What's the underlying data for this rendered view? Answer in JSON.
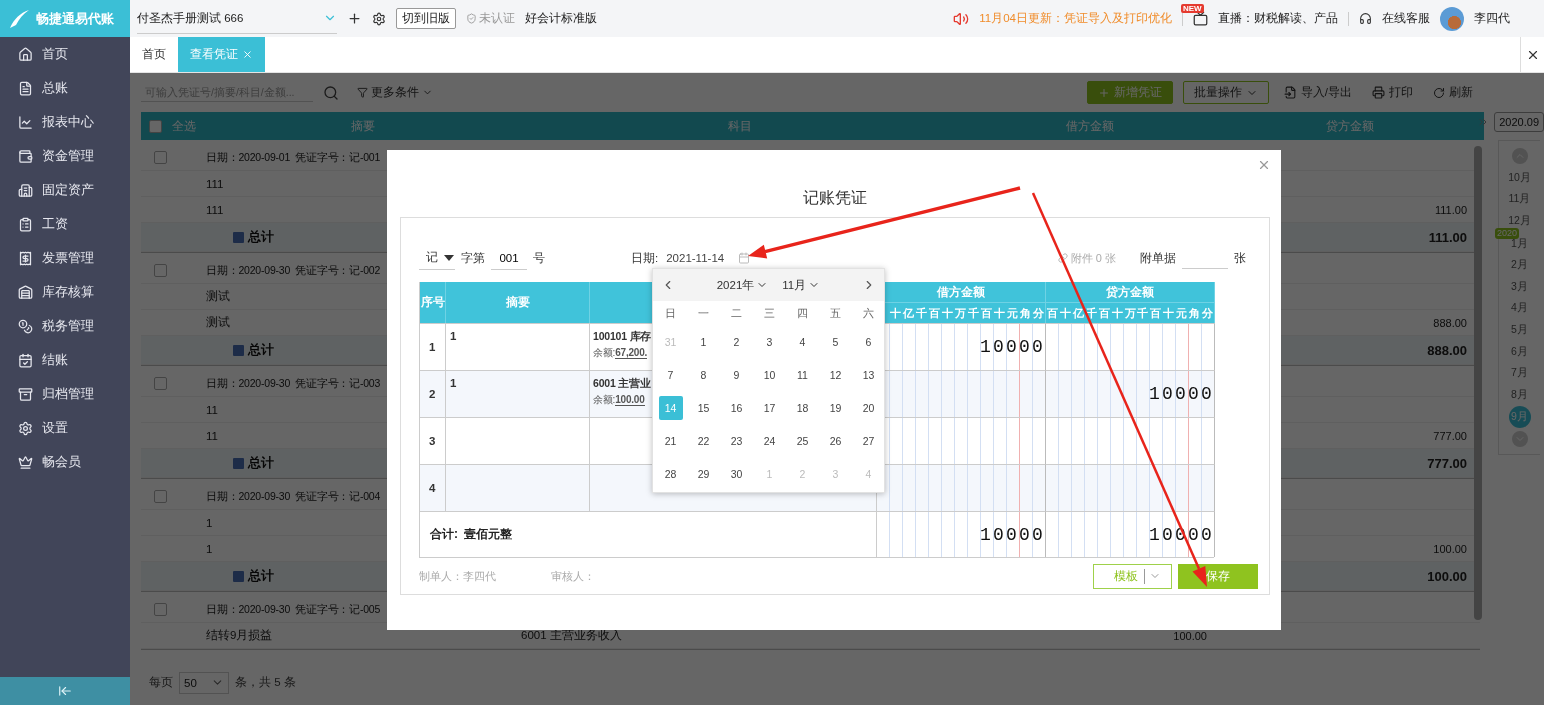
{
  "app": {
    "logo": "畅捷通易代账",
    "company": "付圣杰手册测试 666",
    "switch_version": "切到旧版",
    "certification": "未认证",
    "edition": "好会计标准版",
    "notice": "11月04日更新：凭证导入及打印优化",
    "live_badge": "NEW",
    "live": "直播：财税解读、产品",
    "support": "在线客服",
    "user": "李四代"
  },
  "sidebar": {
    "items": [
      {
        "label": "首页",
        "selected": false
      },
      {
        "label": "总账",
        "selected": false
      },
      {
        "label": "报表中心",
        "selected": false
      },
      {
        "label": "资金管理",
        "selected": false
      },
      {
        "label": "固定资产",
        "selected": false
      },
      {
        "label": "工资",
        "selected": false
      },
      {
        "label": "发票管理",
        "selected": false
      },
      {
        "label": "库存核算",
        "selected": false
      },
      {
        "label": "税务管理",
        "selected": false
      },
      {
        "label": "结账",
        "selected": false
      },
      {
        "label": "归档管理",
        "selected": false
      },
      {
        "label": "设置",
        "selected": false
      },
      {
        "label": "畅会员",
        "selected": false
      }
    ]
  },
  "tabs": [
    {
      "label": "首页",
      "selected": false,
      "closable": false
    },
    {
      "label": "查看凭证",
      "selected": true,
      "closable": true
    }
  ],
  "toolbar": {
    "search_placeholder": "可输入凭证号/摘要/科目/金额...",
    "filter": "更多条件",
    "buttons": [
      {
        "label": "新增凭证",
        "kind": "primary"
      },
      {
        "label": "批量操作",
        "kind": "dropdown"
      },
      {
        "label": "导入/导出",
        "kind": "import"
      },
      {
        "label": "打印",
        "kind": "print"
      },
      {
        "label": "刷新",
        "kind": "refresh"
      }
    ]
  },
  "table": {
    "select_all": "全选",
    "select_all_checked": false,
    "columns": [
      "摘要",
      "科目",
      "借方金额",
      "贷方金额"
    ],
    "groups": [
      {
        "checked": false,
        "date": "日期：2020-09-01",
        "voucher": "凭证字号：记-001",
        "entries": [
          {
            "summary": "111"
          },
          {
            "summary": "111",
            "credit": "111.00"
          }
        ],
        "total_label": "总计",
        "total_credit": "111.00"
      },
      {
        "checked": false,
        "date": "日期：2020-09-30",
        "voucher": "凭证字号：记-002",
        "entries": [
          {
            "summary": "测试"
          },
          {
            "summary": "测试",
            "credit": "888.00"
          }
        ],
        "total_label": "总计",
        "total_credit": "888.00"
      },
      {
        "checked": false,
        "date": "日期：2020-09-30",
        "voucher": "凭证字号：记-003",
        "entries": [
          {
            "summary": "11"
          },
          {
            "summary": "11",
            "credit": "777.00"
          }
        ],
        "total_label": "总计",
        "total_credit": "777.00"
      },
      {
        "checked": false,
        "date": "日期：2020-09-30",
        "voucher": "凭证字号：记-004",
        "entries": [
          {
            "summary": "1"
          },
          {
            "summary": "1",
            "credit": "100.00"
          }
        ],
        "total_label": "总计",
        "total_credit": "100.00"
      },
      {
        "checked": false,
        "date": "日期：2020-09-30",
        "voucher": "凭证字号：记-005",
        "entries": [
          {
            "summary": "结转9月损益",
            "subject": "6001 主营业务收入",
            "debit": "100.00"
          }
        ]
      }
    ]
  },
  "pagination": {
    "per_page_label": "每页",
    "per_page": "50",
    "summary": "条，共 5 条"
  },
  "period_panel": {
    "current": "2020.09",
    "items": [
      {
        "kind": "month",
        "label": "10月",
        "selected": false
      },
      {
        "kind": "month",
        "label": "11月",
        "selected": false
      },
      {
        "kind": "month",
        "label": "12月",
        "selected": false
      },
      {
        "kind": "year",
        "label": "2020"
      },
      {
        "kind": "month",
        "label": "1月",
        "selected": false
      },
      {
        "kind": "month",
        "label": "2月",
        "selected": false
      },
      {
        "kind": "month",
        "label": "3月",
        "selected": false
      },
      {
        "kind": "month",
        "label": "4月",
        "selected": false
      },
      {
        "kind": "month",
        "label": "5月",
        "selected": false
      },
      {
        "kind": "month",
        "label": "6月",
        "selected": false
      },
      {
        "kind": "month",
        "label": "7月",
        "selected": false
      },
      {
        "kind": "month",
        "label": "8月",
        "selected": false
      },
      {
        "kind": "month",
        "label": "9月",
        "selected": true
      }
    ]
  },
  "dialog": {
    "title": "记账凭证",
    "voucher_type": "记",
    "word_label": "字第",
    "number": "001",
    "number_suffix": "号",
    "date_label": "日期:",
    "date": "2021-11-14",
    "attachments": "附件 0 张",
    "receipts_label": "附单据",
    "receipts_unit": "张",
    "columns": {
      "index": "序号",
      "summary": "摘要",
      "debit": "借方金额",
      "credit": "贷方金额"
    },
    "debit_units": [
      "十",
      "亿",
      "千",
      "百",
      "十",
      "万",
      "千",
      "百",
      "十",
      "元",
      "角",
      "分"
    ],
    "credit_units": [
      "百",
      "十",
      "亿",
      "千",
      "百",
      "十",
      "万",
      "千",
      "百",
      "十",
      "元",
      "角",
      "分"
    ],
    "rows": [
      {
        "index": "1",
        "summary": "1",
        "subject": "100101 库存",
        "balance_label": "余额:",
        "balance": "67,200.",
        "debit": "10000"
      },
      {
        "index": "2",
        "summary": "1",
        "subject": "6001 主营业",
        "balance_label": "余额:",
        "balance": "100.00",
        "credit": "10000"
      },
      {
        "index": "3"
      },
      {
        "index": "4"
      }
    ],
    "total_label": "合计:",
    "total_words": "壹佰元整",
    "total_debit": "10000",
    "total_credit": "10000",
    "maker": "制单人：李四代",
    "reviewer": "审核人：",
    "template_button": "模板",
    "save_button": "保存"
  },
  "calendar": {
    "year": "2021年",
    "month": "11月",
    "weekdays": [
      "日",
      "一",
      "二",
      "三",
      "四",
      "五",
      "六"
    ],
    "days": [
      {
        "label": "31",
        "outside": true,
        "selected": false
      },
      {
        "label": "1",
        "outside": false,
        "selected": false
      },
      {
        "label": "2",
        "outside": false,
        "selected": false
      },
      {
        "label": "3",
        "outside": false,
        "selected": false
      },
      {
        "label": "4",
        "outside": false,
        "selected": false
      },
      {
        "label": "5",
        "outside": false,
        "selected": false
      },
      {
        "label": "6",
        "outside": false,
        "selected": false
      },
      {
        "label": "7",
        "outside": false,
        "selected": false
      },
      {
        "label": "8",
        "outside": false,
        "selected": false
      },
      {
        "label": "9",
        "outside": false,
        "selected": false
      },
      {
        "label": "10",
        "outside": false,
        "selected": false
      },
      {
        "label": "11",
        "outside": false,
        "selected": false
      },
      {
        "label": "12",
        "outside": false,
        "selected": false
      },
      {
        "label": "13",
        "outside": false,
        "selected": false
      },
      {
        "label": "14",
        "outside": false,
        "selected": true
      },
      {
        "label": "15",
        "outside": false,
        "selected": false
      },
      {
        "label": "16",
        "outside": false,
        "selected": false
      },
      {
        "label": "17",
        "outside": false,
        "selected": false
      },
      {
        "label": "18",
        "outside": false,
        "selected": false
      },
      {
        "label": "19",
        "outside": false,
        "selected": false
      },
      {
        "label": "20",
        "outside": false,
        "selected": false
      },
      {
        "label": "21",
        "outside": false,
        "selected": false
      },
      {
        "label": "22",
        "outside": false,
        "selected": false
      },
      {
        "label": "23",
        "outside": false,
        "selected": false
      },
      {
        "label": "24",
        "outside": false,
        "selected": false
      },
      {
        "label": "25",
        "outside": false,
        "selected": false
      },
      {
        "label": "26",
        "outside": false,
        "selected": false
      },
      {
        "label": "27",
        "outside": false,
        "selected": false
      },
      {
        "label": "28",
        "outside": false,
        "selected": false
      },
      {
        "label": "29",
        "outside": false,
        "selected": false
      },
      {
        "label": "30",
        "outside": false,
        "selected": false
      },
      {
        "label": "1",
        "outside": true,
        "selected": false
      },
      {
        "label": "2",
        "outside": true,
        "selected": false
      },
      {
        "label": "3",
        "outside": true,
        "selected": false
      },
      {
        "label": "4",
        "outside": true,
        "selected": false
      }
    ]
  }
}
